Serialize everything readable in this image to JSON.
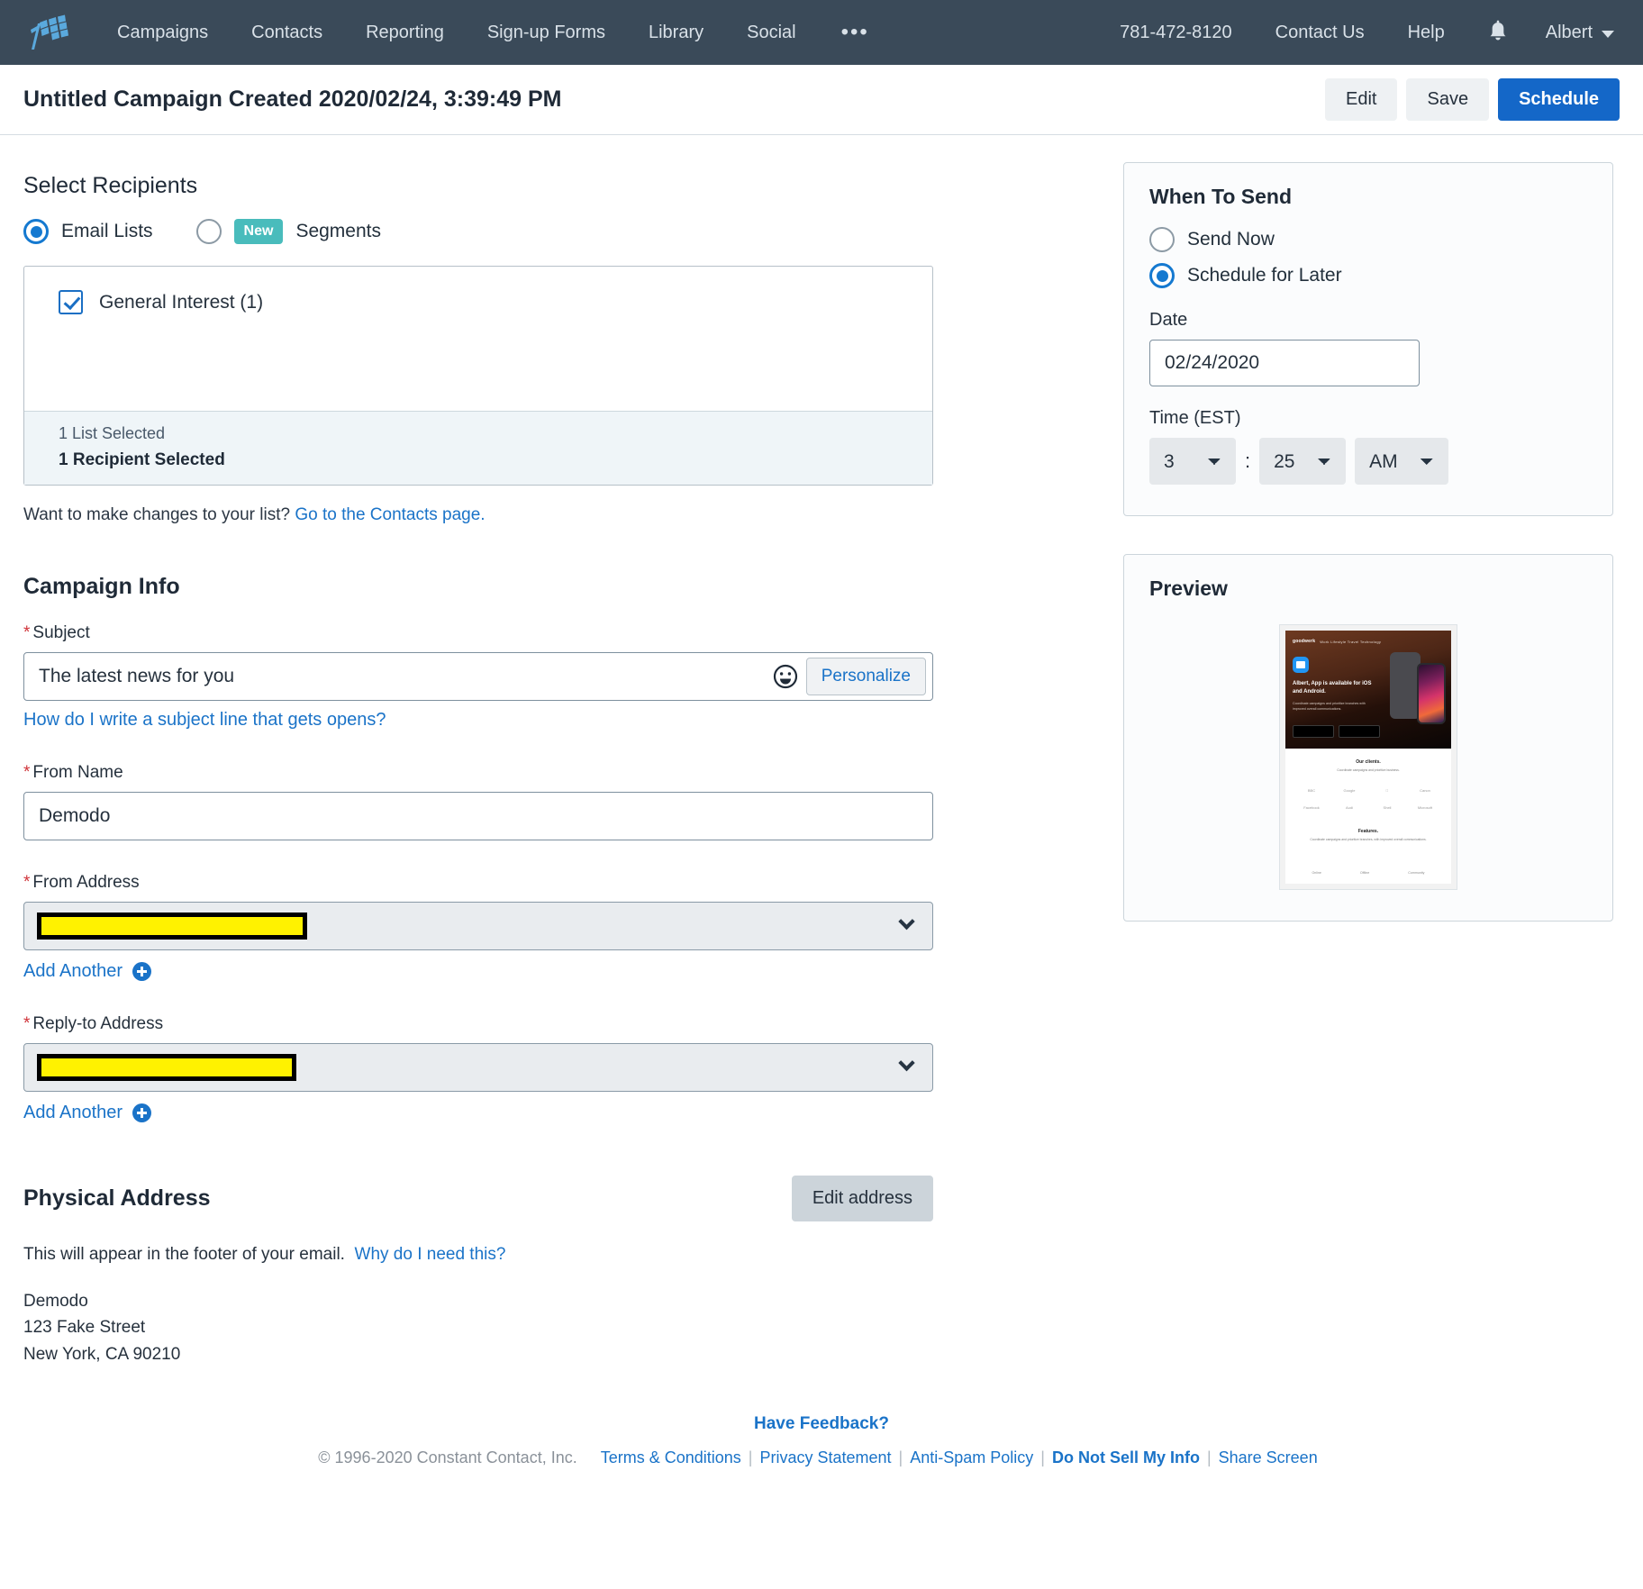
{
  "nav": {
    "logo_icon": "constant-contact-flag-logo",
    "items": [
      {
        "label": "Campaigns"
      },
      {
        "label": "Contacts"
      },
      {
        "label": "Reporting"
      },
      {
        "label": "Sign-up Forms"
      },
      {
        "label": "Library"
      },
      {
        "label": "Social"
      }
    ],
    "more_label": "•••",
    "phone": "781-472-8120",
    "contact_us": "Contact Us",
    "help": "Help",
    "bell_icon": "notification-bell-icon",
    "user": "Albert"
  },
  "subheader": {
    "title": "Untitled Campaign Created 2020/02/24, 3:39:49 PM",
    "edit_label": "Edit",
    "save_label": "Save",
    "schedule_label": "Schedule"
  },
  "recipients": {
    "title": "Select Recipients",
    "option_email_lists": "Email Lists",
    "option_segments": "Segments",
    "segments_badge": "New",
    "selected_mode": "Email Lists",
    "lists": [
      {
        "label": "General Interest (1)",
        "checked": true
      }
    ],
    "summary_lists": "1 List Selected",
    "summary_recipients": "1 Recipient Selected",
    "changes_prefix": "Want to make changes to your list?",
    "changes_link": "Go to the Contacts page."
  },
  "campaign_info": {
    "title": "Campaign Info",
    "subject_label": "Subject",
    "subject_value": "The latest news for you",
    "emoji_icon": "smiley-face-icon",
    "personalize_label": "Personalize",
    "subject_help_link": "How do I write a subject line that gets opens?",
    "from_name_label": "From Name",
    "from_name_value": "Demodo",
    "from_address_label": "From Address",
    "from_address_value": "",
    "reply_to_label": "Reply-to Address",
    "reply_to_value": "",
    "add_another_label": "Add Another",
    "add_icon": "plus-circle-icon",
    "chevron_icon": "chevron-down-icon"
  },
  "physical_address": {
    "title": "Physical Address",
    "edit_button": "Edit address",
    "description": "This will appear in the footer of your email.",
    "why_link": "Why do I need this?",
    "lines": [
      "Demodo",
      "123 Fake Street",
      "New York, CA 90210"
    ]
  },
  "when_to_send": {
    "title": "When To Send",
    "option_send_now": "Send Now",
    "option_schedule": "Schedule for Later",
    "selected_option": "Schedule for Later",
    "date_label": "Date",
    "date_value": "02/24/2020",
    "time_label": "Time (EST)",
    "hour_value": "3",
    "minute_value": "25",
    "meridiem_value": "AM",
    "colon": ":"
  },
  "preview": {
    "title": "Preview",
    "thumb": {
      "logo": "goodwerk",
      "nav": "Work   Lifestyle   Travel   Technology",
      "headline": "Albert, App is available for iOS and Android.",
      "body": "Coordinate campaigns and prioritize branches with improved overall communications.",
      "clients_title": "Our clients.",
      "clients_sub": "Coordinate campaigns and prioritize business.",
      "clients": [
        "BBC",
        "Google",
        "",
        "Canon",
        "Facebook",
        "Audi",
        "Shell",
        "Microsoft"
      ],
      "features_title": "Features.",
      "features_sub": "Coordinate campaigns and prioritize branches, with improved overall communications.",
      "features": [
        "Online",
        "Offline",
        "Community"
      ]
    }
  },
  "footer": {
    "feedback": "Have Feedback?",
    "copyright": "© 1996-2020 Constant Contact, Inc.",
    "links": [
      {
        "label": "Terms & Conditions",
        "bold": false
      },
      {
        "label": "Privacy Statement",
        "bold": false
      },
      {
        "label": "Anti-Spam Policy",
        "bold": false
      },
      {
        "label": "Do Not Sell My Info",
        "bold": true
      },
      {
        "label": "Share Screen",
        "bold": false
      }
    ]
  },
  "colors": {
    "nav_bg": "#3a4a59",
    "primary_blue": "#1467c8",
    "link_blue": "#1a73c8",
    "badge_teal": "#49bcbc",
    "required_red": "#d0343a",
    "redaction_yellow": "#fff200",
    "summary_bg": "#eff5f8"
  }
}
